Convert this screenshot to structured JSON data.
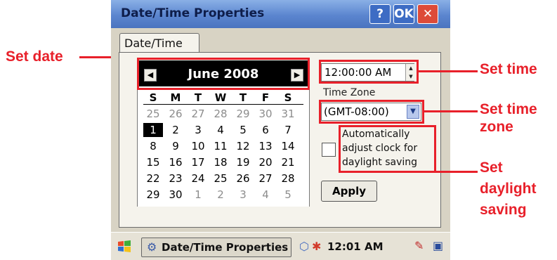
{
  "window": {
    "title": "Date/Time Properties",
    "help_label": "?",
    "ok_label": "OK",
    "close_label": "✕",
    "tab_label": "Date/Time"
  },
  "calendar": {
    "month_label": "June 2008",
    "prev_label": "◀",
    "next_label": "▶",
    "weekdays": [
      "S",
      "M",
      "T",
      "W",
      "T",
      "F",
      "S"
    ],
    "weeks": [
      [
        "25",
        "26",
        "27",
        "28",
        "29",
        "30",
        "31"
      ],
      [
        "1",
        "2",
        "3",
        "4",
        "5",
        "6",
        "7"
      ],
      [
        "8",
        "9",
        "10",
        "11",
        "12",
        "13",
        "14"
      ],
      [
        "15",
        "16",
        "17",
        "18",
        "19",
        "20",
        "21"
      ],
      [
        "22",
        "23",
        "24",
        "25",
        "26",
        "27",
        "28"
      ],
      [
        "29",
        "30",
        "1",
        "2",
        "3",
        "4",
        "5"
      ]
    ],
    "selected_day": "1"
  },
  "time": {
    "value": "12:00:00 AM",
    "spin_up": "▲",
    "spin_down": "▼"
  },
  "timezone": {
    "label": "Time Zone",
    "value": "(GMT-08:00)",
    "arrow": "▼"
  },
  "dst": {
    "label_lines": [
      "Automatically",
      "adjust clock for",
      "daylight saving"
    ],
    "checked": false
  },
  "apply_label": "Apply",
  "taskbar": {
    "task_label": "Date/Time Properties",
    "clock": "12:01 AM"
  },
  "callouts": {
    "set_date": "Set date",
    "set_time": "Set time",
    "set_timezone_1": "Set time",
    "set_timezone_2": "zone",
    "set_dst_1": "Set",
    "set_dst_2": "daylight",
    "set_dst_3": "saving"
  },
  "colors": {
    "annotation": "#e8202a",
    "titlebar": "#5b85cf",
    "calendar_header": "#000000"
  }
}
